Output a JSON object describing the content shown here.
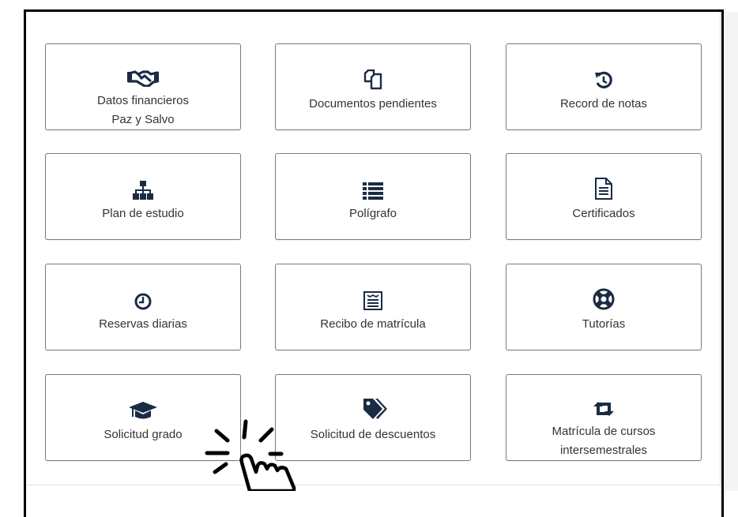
{
  "colors": {
    "icon": "#1a2b44",
    "text": "#333333",
    "border": "#7a7a7a"
  },
  "cards": [
    {
      "icon": "handshake-icon",
      "line1": "Datos financieros",
      "line2": "Paz y Salvo"
    },
    {
      "icon": "copy-icon",
      "line1": "Documentos pendientes",
      "line2": ""
    },
    {
      "icon": "history-icon",
      "line1": "Record de notas",
      "line2": ""
    },
    {
      "icon": "sitemap-icon",
      "line1": "Plan de estudio",
      "line2": ""
    },
    {
      "icon": "list-icon",
      "line1": "Polígrafo",
      "line2": ""
    },
    {
      "icon": "file-text-icon",
      "line1": "Certificados",
      "line2": ""
    },
    {
      "icon": "clock-icon",
      "line1": "Reservas diarias",
      "line2": ""
    },
    {
      "icon": "receipt-icon",
      "line1": "Recibo de matrícula",
      "line2": ""
    },
    {
      "icon": "life-ring-icon",
      "line1": "Tutorías",
      "line2": ""
    },
    {
      "icon": "graduation-cap-icon",
      "line1": "Solicitud grado",
      "line2": ""
    },
    {
      "icon": "tags-icon",
      "line1": "Solicitud de descuentos",
      "line2": ""
    },
    {
      "icon": "retweet-icon",
      "line1": "Matrícula de cursos",
      "line2": "intersemestrales"
    }
  ]
}
